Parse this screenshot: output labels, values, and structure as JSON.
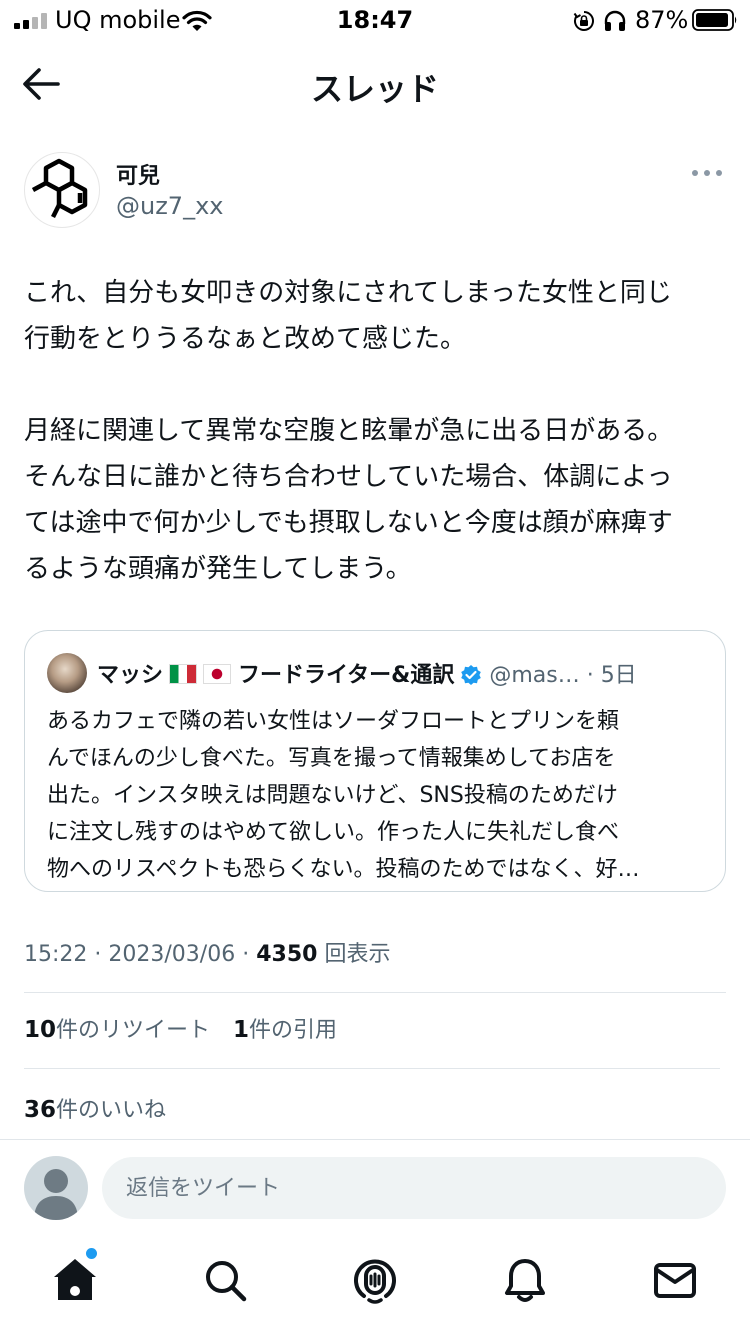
{
  "status_bar": {
    "carrier": "UQ mobile",
    "time": "18:47",
    "battery_percent": "87%",
    "icons": [
      "signal-icon",
      "wifi-icon",
      "orientation-lock-icon",
      "headphones-icon",
      "battery-icon"
    ]
  },
  "header": {
    "back_icon": "arrow-left-icon",
    "title": "スレッド"
  },
  "tweet": {
    "author": {
      "name": "可兒",
      "handle": "@uz7_xx"
    },
    "more_icon": "more-horizontal-icon",
    "text_lines": [
      "これ、自分も女叩きの対象にされてしまった女性と同じ",
      "行動をとりうるなぁと改めて感じた。",
      "月経に関連して異常な空腹と眩暈が急に出る日がある。",
      "そんな日に誰かと待ち合わせしていた場合、体調によっ",
      "ては途中で何か少しでも摂取しないと今度は顔が麻痺す",
      "るような頭痛が発生してしまう。"
    ],
    "quote": {
      "name": "マッシ",
      "title": "フードライター&通訳",
      "handle": "@mas…",
      "time": "· 5日",
      "flags": [
        "flag-italy",
        "flag-japan"
      ],
      "verified_icon": "verified-badge-icon",
      "text_lines": [
        "あるカフェで隣の若い女性はソーダフロートとプリンを頼",
        "んでほんの少し食べた。写真を撮って情報集めしてお店を",
        "出た。インスタ映えは問題ないけど、SNS投稿のためだけ",
        "に注文し残すのはやめて欲しい。作った人に失礼だし食べ",
        "物へのリスペクトも恐らくない。投稿のためではなく、好…"
      ]
    },
    "meta": {
      "time": "15:22",
      "separator": "·",
      "date": "2023/03/06",
      "views": "4350",
      "views_label": "回表示"
    },
    "stats": {
      "retweets": "10",
      "retweets_label": "件のリツイート",
      "quotes": "1",
      "quotes_label": "件の引用",
      "likes": "36",
      "likes_label": "件のいいね"
    }
  },
  "reply": {
    "placeholder": "返信をツイート"
  },
  "tab_bar": {
    "items": [
      "home-icon",
      "search-icon",
      "spaces-icon",
      "notifications-icon",
      "messages-icon"
    ],
    "accent": "#1d9bf0"
  }
}
